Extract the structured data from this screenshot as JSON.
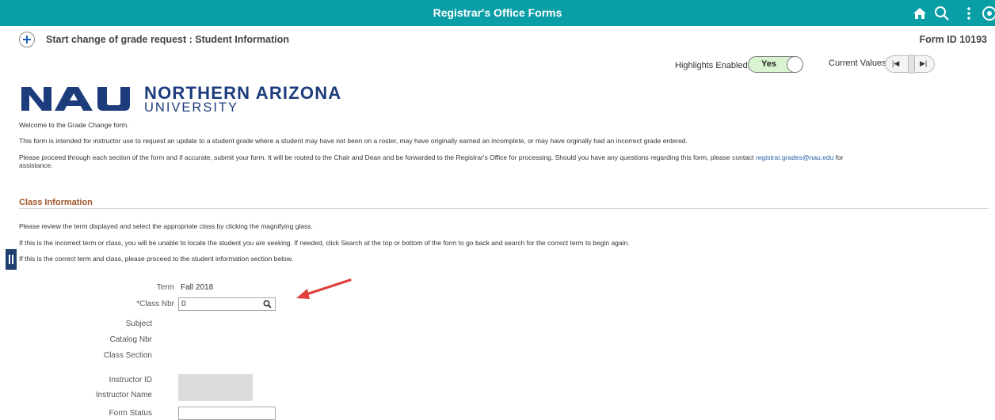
{
  "header": {
    "title": "Registrar's Office Forms"
  },
  "subheader": {
    "page_title": "Start change of grade request : Student Information",
    "form_id": "Form ID 10193"
  },
  "controls": {
    "highlights_label": "Highlights Enabled:",
    "highlights_value": "Yes",
    "current_values_label": "Current Values"
  },
  "logo": {
    "mark": "NAU",
    "northern": "NORTHERN ARIZONA",
    "university": "UNIVERSITY"
  },
  "intro": {
    "welcome": "Welcome to the Grade Change form.",
    "purpose": "This form is intended for instructor use to request an update to a student grade where a student may have not been on a roster, may have originally earned an incomplete, or may have orginally had an incorrect grade entered.",
    "proceed_a": "Please proceed through each section of the form and if accurate, submit your form.  It will be routed to the Chair and Dean and be forwarded to the Registrar's Office for processing.  Should you have any questions regarding this form, please contact ",
    "email": "registrar.grades@nau.edu",
    "proceed_b": " for",
    "proceed_c": "assistance."
  },
  "class_info": {
    "title": "Class Information",
    "p1": "Please review the term displayed and select the appropriate class by clicking the magnifying glass.",
    "p2": "If this is the incorrect term or class, you will be unable to locate the student you are seeking.  If needed, click Search at the top or bottom of the form to go back and search for the correct term to begin again.",
    "p3": "If this is the correct term and class, please proceed to the student information section below."
  },
  "fields": {
    "term_label": "Term",
    "term_value": "Fall 2018",
    "class_nbr_label": "*Class Nbr",
    "class_nbr_value": "0",
    "subject_label": "Subject",
    "catalog_label": "Catalog Nbr",
    "section_label": "Class Section",
    "instructor_id_label": "Instructor ID",
    "instructor_name_label": "Instructor Name",
    "form_status_label": "Form Status"
  },
  "colors": {
    "header_bg": "#0a9ea6",
    "brand_blue": "#1c3c7c",
    "section_title": "#a0562a",
    "arrow": "#e0403a"
  }
}
